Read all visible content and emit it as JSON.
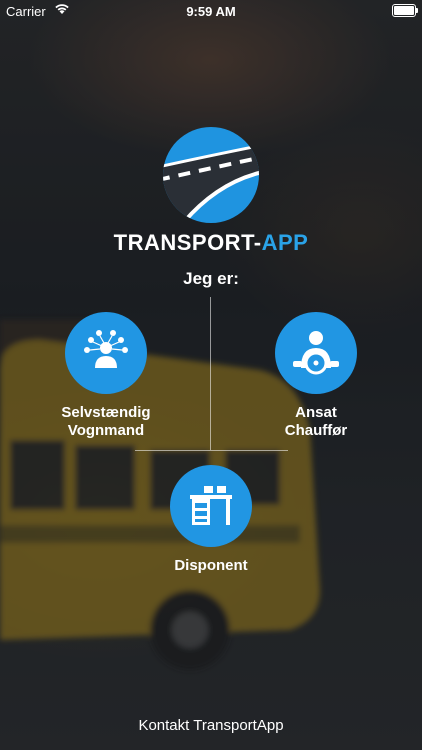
{
  "status_bar": {
    "carrier": "Carrier",
    "time": "9:59 AM",
    "wifi_icon": "wifi-icon",
    "battery_icon": "battery-icon"
  },
  "brand": {
    "name_part1": "TRANSPORT-",
    "name_part2": "APP",
    "accent_color": "#2aa3e8",
    "logo_icon": "road-logo-icon"
  },
  "prompt": "Jeg er:",
  "roles": [
    {
      "line1": "Selvstændig",
      "line2": "Vognmand",
      "icon": "network-person-icon"
    },
    {
      "line1": "Ansat",
      "line2": "Chauffør",
      "icon": "driver-steering-wheel-icon"
    },
    {
      "line1": "Disponent",
      "line2": "",
      "icon": "desk-icon"
    }
  ],
  "footer": {
    "contact_label": "Kontakt TransportApp"
  },
  "colors": {
    "primary_blue": "#2196e3",
    "logo_dark": "#2a2f36"
  }
}
